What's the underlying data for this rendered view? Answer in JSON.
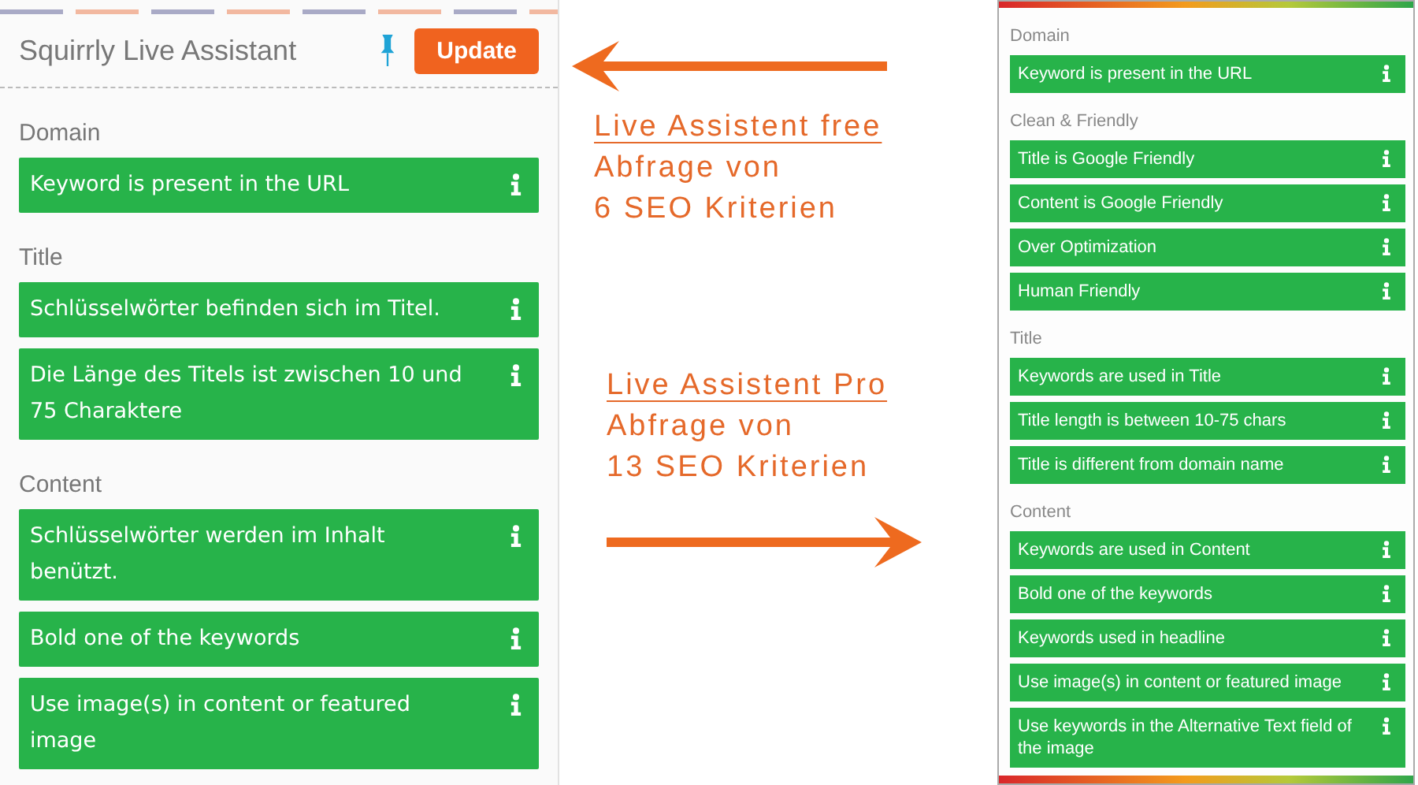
{
  "free_panel": {
    "title": "Squirrly Live Assistant",
    "button": "Update",
    "sections": [
      {
        "heading": "Domain",
        "items": [
          "Keyword is present in the URL"
        ]
      },
      {
        "heading": "Title",
        "items": [
          "Schlüsselwörter befinden sich im Titel.",
          "Die Länge des Titels ist zwischen 10 und 75 Charaktere"
        ]
      },
      {
        "heading": "Content",
        "items": [
          "Schlüsselwörter werden im Inhalt benützt.",
          "Bold one of the keywords",
          "Use image(s) in content or featured image"
        ]
      }
    ]
  },
  "callouts": [
    {
      "kind": "left",
      "heading": "Live Assistent free",
      "lines": [
        "Abfrage von",
        "6 SEO Kriterien"
      ]
    },
    {
      "kind": "right",
      "heading": "Live Assistent Pro",
      "lines": [
        "Abfrage von",
        "13 SEO Kriterien"
      ]
    }
  ],
  "pro_panel": {
    "sections": [
      {
        "heading": "Domain",
        "items": [
          "Keyword is present in the URL"
        ]
      },
      {
        "heading": "Clean & Friendly",
        "items": [
          "Title is Google Friendly",
          "Content is Google Friendly",
          "Over Optimization",
          "Human Friendly"
        ]
      },
      {
        "heading": "Title",
        "items": [
          "Keywords are used in Title",
          "Title length is between 10-75 chars",
          "Title is different from domain name"
        ]
      },
      {
        "heading": "Content",
        "items": [
          "Keywords are used in Content",
          "Bold one of the keywords",
          "Keywords used in headline",
          "Use image(s) in content or featured image",
          "Use keywords in the Alternative Text field of the image"
        ]
      }
    ]
  }
}
